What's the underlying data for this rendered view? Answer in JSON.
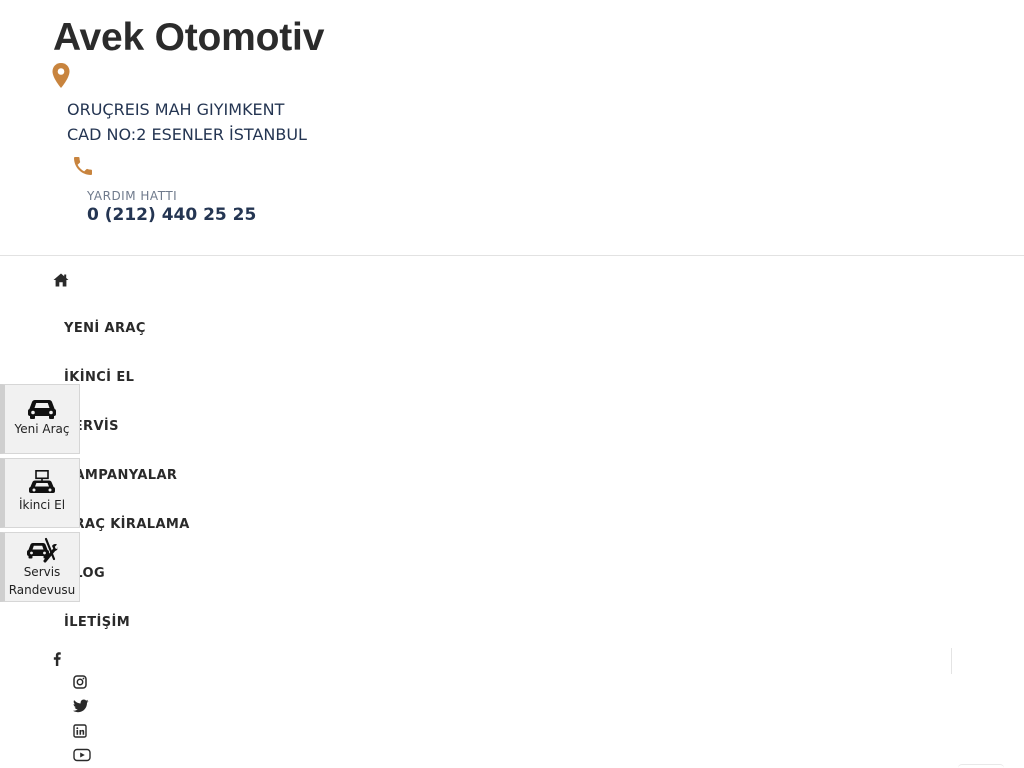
{
  "header": {
    "logo_text": "Avek Otomotiv",
    "address_line1": "ORUÇREIS MAH GIYIMKENT",
    "address_line2": "CAD NO:2 ESENLER İSTANBUL",
    "help_label": "YARDIM HATTI",
    "phone": "0 (212) 440 25 25",
    "accent_color": "#c8843e"
  },
  "nav": {
    "items": [
      {
        "label": "YENİ ARAÇ"
      },
      {
        "label": "İKİNCİ EL"
      },
      {
        "label": "SERVİS"
      },
      {
        "label": "KAMPANYALAR"
      },
      {
        "label": "ARAÇ KİRALAMA"
      },
      {
        "label": "BLOG"
      },
      {
        "label": "İLETİŞİM"
      }
    ]
  },
  "social": [
    "facebook-icon",
    "instagram-icon",
    "twitter-icon",
    "linkedin-icon",
    "youtube-icon"
  ],
  "side_tabs": [
    {
      "label": "Yeni Araç",
      "icon": "car-icon"
    },
    {
      "label": "İkinci El",
      "icon": "car-sign-icon"
    },
    {
      "label": "Servis Randevusu",
      "icon": "car-wrench-icon"
    }
  ]
}
